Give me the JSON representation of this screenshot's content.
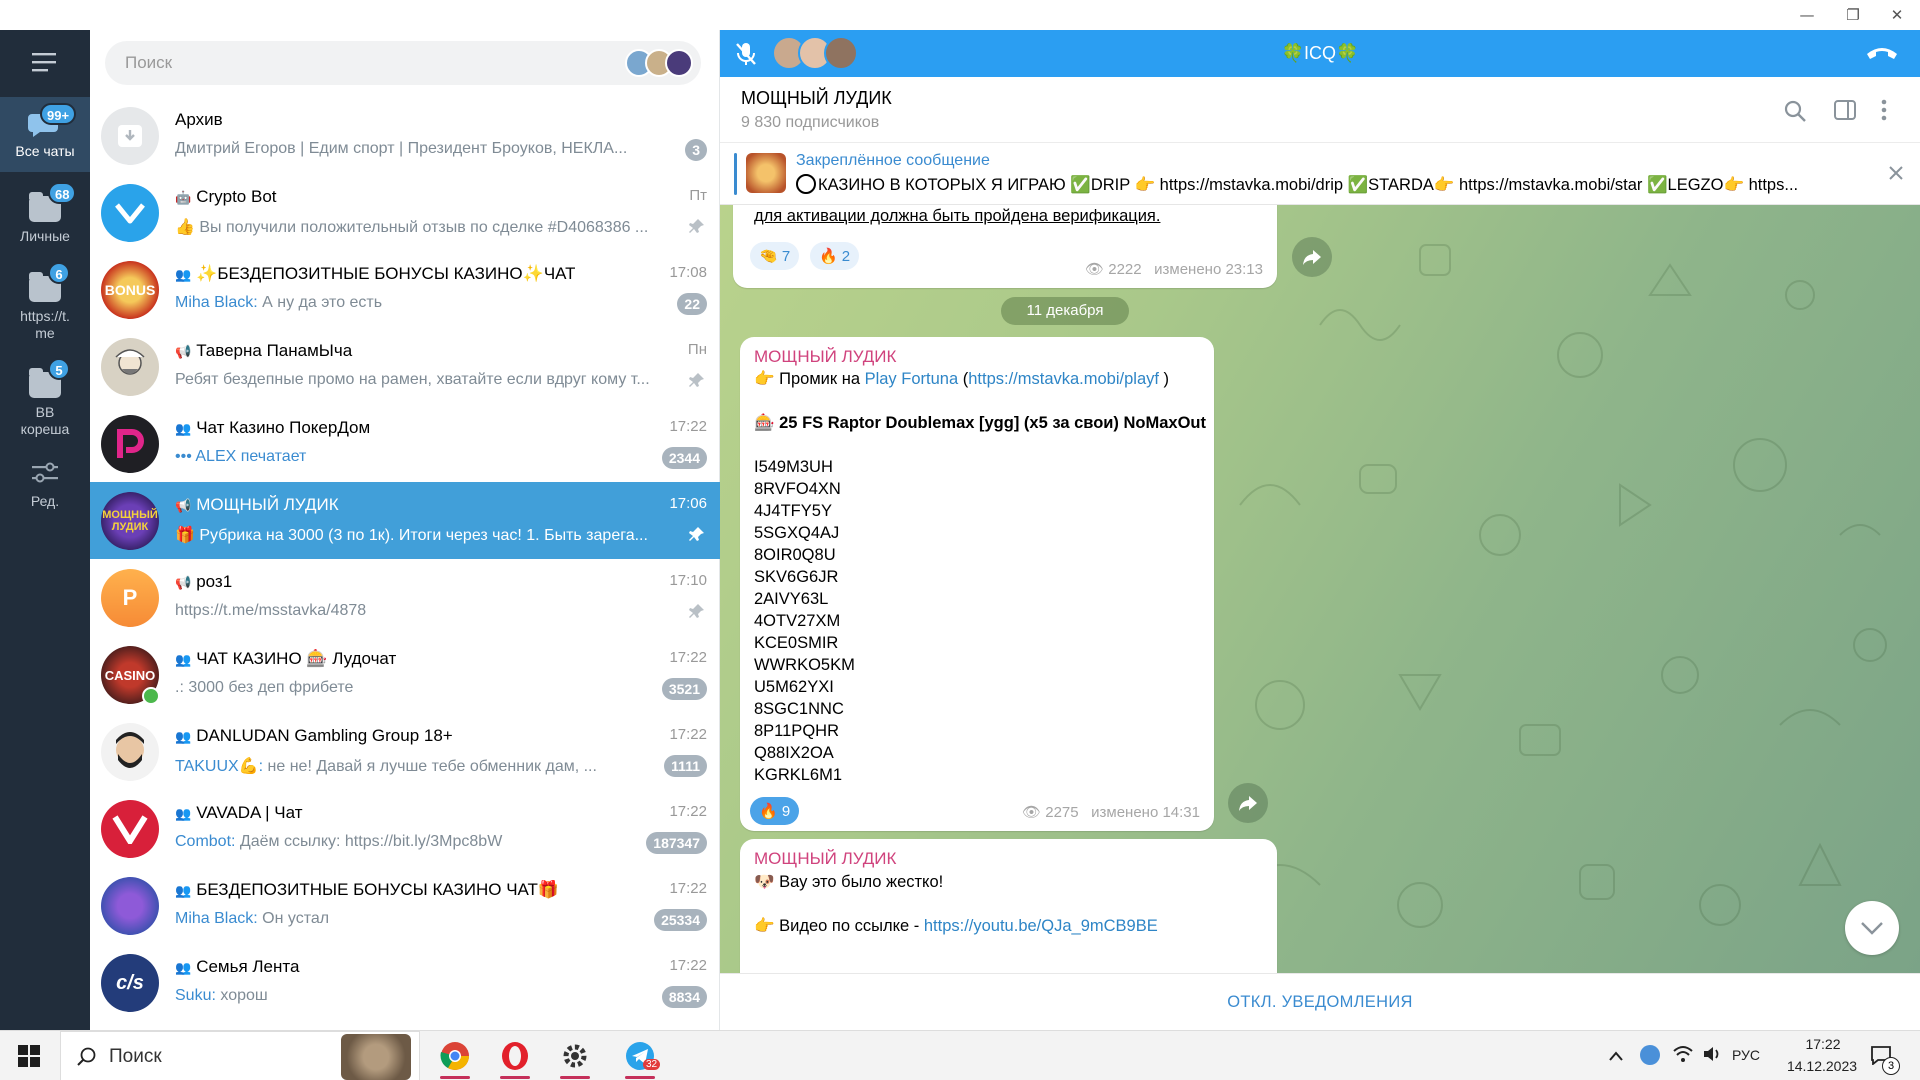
{
  "window": {
    "minimize": "—",
    "restore": "❐",
    "close": "✕"
  },
  "nav": {
    "menu_icon": "hamburger-icon",
    "items": [
      {
        "label": "Все чаты",
        "badge": "99+"
      },
      {
        "label": "Личные",
        "badge": "68"
      },
      {
        "label": "https://t.me",
        "badge": "6"
      },
      {
        "label": "BB кореша",
        "badge": "5"
      },
      {
        "label": "Ред."
      }
    ]
  },
  "search": {
    "placeholder": "Поиск"
  },
  "chats": [
    {
      "name": "Архив",
      "time": "",
      "preview": "Дмитрий Егоров | Едим спорт | Президент Броуков, НЕКЛА...",
      "badge": "3",
      "kind": ""
    },
    {
      "name": "Crypto Bot",
      "time": "Пт",
      "preview": "👍 Вы получили положительный отзыв по сделке #D4068386 ...",
      "kind": "🤖",
      "pinned": true
    },
    {
      "name": "✨БЕЗДЕПОЗИТНЫЕ БОНУСЫ КАЗИНО✨ЧАТ",
      "time": "17:08",
      "sender": "Miha Black:",
      "preview": " А ну да это есть",
      "badge": "22",
      "kind": "👥"
    },
    {
      "name": "Таверна ПанамЫча",
      "time": "Пн",
      "preview": "Ребят бездепные промо на рамен, хватайте если вдруг кому т...",
      "kind": "📢",
      "pinned": true
    },
    {
      "name": "Чат Казино ПокерДом",
      "time": "17:22",
      "sender": "••• ALEX",
      "preview": " печатает",
      "badge": "2344",
      "kind": "👥"
    },
    {
      "name": "МОЩНЫЙ ЛУДИК",
      "time": "17:06",
      "preview": "🎁 Рубрика на 3000 (3 по 1к). Итоги через час!  1. Быть зарега...",
      "kind": "📢",
      "pinned": true
    },
    {
      "name": "роз1",
      "time": "17:10",
      "preview": "https://t.me/msstavka/4878",
      "kind": "📢",
      "pinned": true,
      "avatar_letter": "P"
    },
    {
      "name": "ЧАТ КАЗИНО 🎰 Лудочат",
      "time": "17:22",
      "preview": ".: 3000 без деп фрибете",
      "badge": "3521",
      "kind": "👥"
    },
    {
      "name": "DANLUDAN Gambling Group 18+",
      "time": "17:22",
      "sender": "TAKUUX💪:",
      "preview": " не не! Давай я лучше тебе обменник дам, ...",
      "badge": "1111",
      "kind": "👥"
    },
    {
      "name": "VAVADA | Чат",
      "time": "17:22",
      "sender": "Combot:",
      "preview": " Даём ссылку: https://bit.ly/3Mpc8bW",
      "badge": "187347",
      "kind": "👥"
    },
    {
      "name": "БЕЗДЕПОЗИТНЫЕ БОНУСЫ КАЗИНО ЧАТ🎁",
      "time": "17:22",
      "sender": "Miha Black:",
      "preview": " Он устал",
      "badge": "25334",
      "kind": "👥"
    },
    {
      "name": "Семья Лента",
      "time": "17:22",
      "sender": "Suku:",
      "preview": " хорош",
      "badge": "8834",
      "kind": "👥"
    }
  ],
  "callbar": {
    "title": "🍀ICQ🍀"
  },
  "header": {
    "title": "МОЩНЫЙ ЛУДИК",
    "subtitle": "9 830 подписчиков"
  },
  "pinned": {
    "label": "Закреплённое сообщение",
    "text": "КАЗИНО В КОТОРЫХ Я ИГРАЮ ✅DRIP 👉 https://mstavka.mobi/drip ✅STARDA👉 https://mstavka.mobi/star ✅LEGZO👉 https..."
  },
  "msg1": {
    "tail_text": "для активации должна быть пройдена верификация.",
    "reactions": [
      {
        "emoji": "🤏",
        "count": "7"
      },
      {
        "emoji": "🔥",
        "count": "2"
      }
    ],
    "views": "2222",
    "edited": "изменено 23:13"
  },
  "date_sep": "11 декабря",
  "msg2": {
    "author": "МОЩНЫЙ ЛУДИК",
    "line1_prefix": "👉 Промик на ",
    "line1_link": "Play Fortuna",
    "line1_paren_open": " (",
    "line1_url": "https://mstavka.mobi/playf",
    "line1_paren_close": " )",
    "line2": "🎰 25 FS Raptor Doublemax [ygg]  (x5 за свои) NoMaxOut",
    "codes": [
      "I549M3UH",
      "8RVFO4XN",
      "4J4TFY5Y",
      "5SGXQ4AJ",
      "8OIR0Q8U",
      "SKV6G6JR",
      "2AIVY63L",
      "4OTV27XM",
      "KCE0SMIR",
      "WWRKO5KM",
      "U5M62YXI",
      "8SGC1NNC",
      "8P11PQHR",
      "Q88IX2OA",
      "KGRKL6M1"
    ],
    "reaction": {
      "emoji": "🔥",
      "count": "9"
    },
    "views": "2275",
    "edited": "изменено 14:31"
  },
  "msg3": {
    "author": "МОЩНЫЙ ЛУДИК",
    "line1": "🐶 Вау это было жестко!",
    "line2_prefix": "👉 Видео по ссылке -  ",
    "line2_url": "https://youtu.be/QJa_9mCB9BE"
  },
  "bottom": {
    "mute_label": "ОТКЛ. УВЕДОМЛЕНИЯ"
  },
  "taskbar": {
    "search_label": "Поиск",
    "lang": "РУС",
    "time": "17:22",
    "date": "14.12.2023",
    "notif_count": "3",
    "telegram_badge": "32"
  },
  "colors": {
    "accent": "#419fd9",
    "nav_bg": "#212d3b",
    "author": "#d0437d",
    "link": "#2e85c6",
    "callbar": "#2b9ef2"
  }
}
